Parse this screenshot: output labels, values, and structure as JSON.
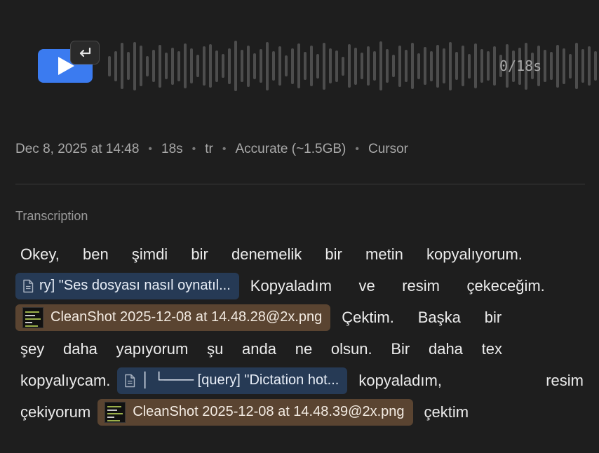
{
  "player": {
    "duration": "0/18s",
    "accent": "#3b7bf0",
    "icons": [
      "play-icon",
      "return-icon"
    ],
    "waveform_levels": [
      0.36,
      0.54,
      0.82,
      0.5,
      0.86,
      0.72,
      0.36,
      0.58,
      0.76,
      0.48,
      0.66,
      0.54,
      0.8,
      0.62,
      0.4,
      0.7,
      0.78,
      0.56,
      0.42,
      0.64,
      0.9,
      0.58,
      0.74,
      0.46,
      0.6,
      0.86,
      0.52,
      0.7,
      0.38,
      0.64,
      0.8,
      0.5,
      0.72,
      0.44,
      0.84,
      0.62,
      0.56,
      0.34,
      0.78,
      0.66,
      0.48,
      0.7,
      0.52,
      0.88,
      0.6,
      0.4,
      0.74,
      0.58,
      0.82,
      0.46,
      0.68,
      0.54,
      0.76,
      0.62,
      0.86,
      0.5,
      0.72,
      0.44,
      0.8,
      0.6,
      0.52,
      0.7,
      0.4,
      0.78,
      0.56,
      0.66,
      0.84,
      0.48,
      0.72,
      0.58,
      0.5,
      0.76,
      0.64,
      0.44,
      0.82,
      0.6,
      0.7,
      0.52,
      0.88,
      0.62,
      0.46
    ]
  },
  "meta": {
    "date": "Dec 8, 2025 at 14:48",
    "length": "18s",
    "language": "tr",
    "model": "Accurate (~1.5GB)",
    "app": "Cursor",
    "separator": "•"
  },
  "transcription": {
    "label": "Transcription",
    "line1": [
      "Okey,",
      "ben",
      "şimdi",
      "bir",
      "denemelik",
      "bir",
      "metin",
      "kopyalıyorum."
    ],
    "chip1": "ry] \"Ses dosyası nasıl oynatıl...",
    "line2_words": [
      "Kopyaladım",
      "ve",
      "resim",
      "çekeceğim."
    ],
    "chip2": "CleanShot 2025-12-08 at 14.48.28@2x.png",
    "line3_words": [
      "Çektim.",
      "Başka",
      "bir"
    ],
    "line4": [
      "şey",
      "daha",
      "yapıyorum",
      "şu",
      "anda",
      "ne",
      "olsun.",
      "Bir",
      "daha",
      "tex"
    ],
    "line5_start": "kopyalıycam.",
    "chip3": "│    └─── [query] \"Dictation hot...",
    "line5_words": [
      "kopyaladım,",
      "resim"
    ],
    "line6_start": "çekiyorum",
    "chip4": "CleanShot 2025-12-08 at 14.48.39@2x.png",
    "line6_end": "çektim",
    "text_chip_color": "#263a55",
    "image_chip_color": "#5a4431"
  }
}
